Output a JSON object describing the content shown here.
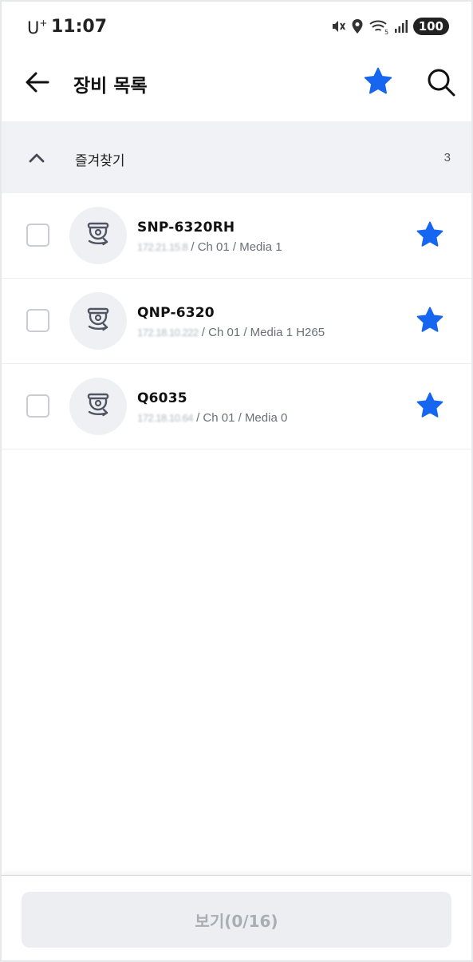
{
  "status_bar": {
    "carrier": "U",
    "carrier_sup": "+",
    "time": "11:07",
    "battery": "100"
  },
  "header": {
    "title": "장비 목록"
  },
  "favorites_section": {
    "title": "즐겨찾기",
    "count": "3"
  },
  "devices": [
    {
      "name": "SNP-6320RH",
      "ip": "172.21.15.8",
      "detail": " / Ch 01 / Media 1"
    },
    {
      "name": "QNP-6320",
      "ip": "172.18.10.222",
      "detail": " / Ch 01 / Media 1 H265"
    },
    {
      "name": "Q6035",
      "ip": "172.18.10.64",
      "detail": " / Ch 01 / Media 0"
    }
  ],
  "footer": {
    "view_button": "보기(0/16)"
  },
  "colors": {
    "accent_blue": "#1766f0",
    "icon_gray": "#4f5563",
    "disabled_text": "#a9adb4"
  },
  "icons": {
    "back": "arrow-left-icon",
    "favorite": "star-icon",
    "search": "search-icon",
    "collapse": "chevron-up-icon",
    "device": "dome-camera-icon"
  }
}
